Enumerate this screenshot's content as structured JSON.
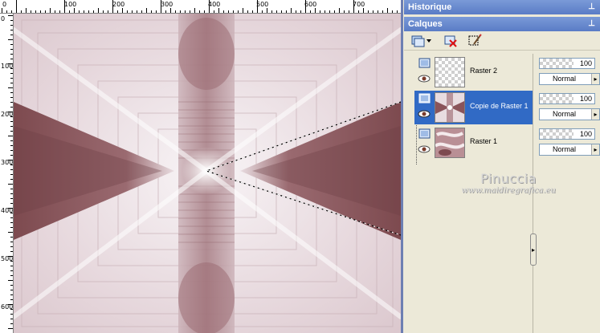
{
  "rulers": {
    "top_labels": [
      "0",
      "100",
      "200",
      "300",
      "400",
      "500",
      "600",
      "700"
    ],
    "left_labels": [
      "0",
      "100",
      "200",
      "300",
      "400",
      "500",
      "600"
    ]
  },
  "panels": {
    "history": {
      "title": "Historique"
    },
    "layers": {
      "title": "Calques",
      "toolbar_icons": [
        "new-layer-icon",
        "delete-layer-icon",
        "edit-selection-icon"
      ],
      "layers": [
        {
          "name": "Raster 2",
          "opacity": "100",
          "blend_mode": "Normal",
          "selected": false,
          "thumb": "transparent"
        },
        {
          "name": "Copie de Raster 1",
          "opacity": "100",
          "blend_mode": "Normal",
          "selected": true,
          "thumb": "star"
        },
        {
          "name": "Raster 1",
          "opacity": "100",
          "blend_mode": "Normal",
          "selected": false,
          "thumb": "swirl"
        }
      ]
    }
  },
  "watermark": {
    "line1": "Pinuccia",
    "line2": "www.maidiregrafica.eu"
  },
  "colors": {
    "accent": "#316ac5",
    "title_bar": "#5a7cc6",
    "image_dark": "#7d4a4f",
    "image_light": "#f4eef1",
    "panel_bg": "#ece9d8"
  }
}
